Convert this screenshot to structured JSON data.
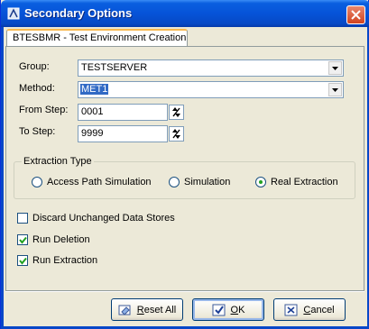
{
  "window": {
    "title": "Secondary Options",
    "icon": "dialog-app-icon"
  },
  "tab": {
    "label": "BTESBMR - Test Environment Creation"
  },
  "form": {
    "group_label": "Group:",
    "group_value": "TESTSERVER",
    "method_label": "Method:",
    "method_value": "MET1",
    "from_step_label": "From Step:",
    "from_step_value": "0001",
    "to_step_label": "To Step:",
    "to_step_value": "9999"
  },
  "extraction_type": {
    "title": "Extraction Type",
    "options": [
      {
        "label": "Access Path Simulation",
        "selected": false
      },
      {
        "label": "Simulation",
        "selected": false
      },
      {
        "label": "Real Extraction",
        "selected": true
      }
    ]
  },
  "checkboxes": [
    {
      "label": "Discard Unchanged Data Stores",
      "checked": false
    },
    {
      "label": "Run Deletion",
      "checked": true
    },
    {
      "label": "Run Extraction",
      "checked": true
    }
  ],
  "buttons": {
    "reset_all": {
      "prefix": "",
      "mnemonic": "R",
      "rest": "eset All"
    },
    "ok": {
      "prefix": "",
      "mnemonic": "O",
      "rest": "K"
    },
    "cancel": {
      "prefix": "",
      "mnemonic": "C",
      "rest": "ancel"
    }
  },
  "colors": {
    "titlebar": "#0653d8",
    "selection": "#316ac5",
    "face": "#ece9d8"
  }
}
